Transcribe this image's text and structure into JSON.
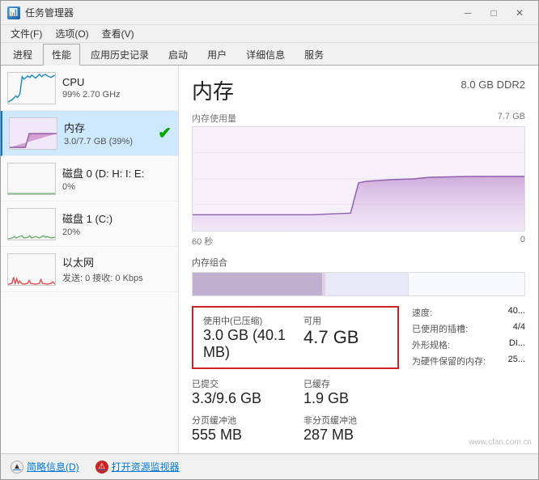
{
  "window": {
    "title": "任务管理器",
    "icon": "📊"
  },
  "titlebar": {
    "minimize": "─",
    "maximize": "□",
    "close": "✕"
  },
  "menubar": {
    "items": [
      "文件(F)",
      "选项(O)",
      "查看(V)"
    ]
  },
  "tabs": [
    {
      "label": "进程",
      "active": false
    },
    {
      "label": "性能",
      "active": true
    },
    {
      "label": "应用历史记录",
      "active": false
    },
    {
      "label": "启动",
      "active": false
    },
    {
      "label": "用户",
      "active": false
    },
    {
      "label": "详细信息",
      "active": false
    },
    {
      "label": "服务",
      "active": false
    }
  ],
  "sidebar": {
    "items": [
      {
        "id": "cpu",
        "label": "CPU",
        "sublabel": "99% 2.70 GHz",
        "active": false
      },
      {
        "id": "memory",
        "label": "内存",
        "sublabel": "3.0/7.7 GB (39%)",
        "active": true,
        "check": true
      },
      {
        "id": "disk0",
        "label": "磁盘 0 (D: H: I: E:",
        "sublabel": "0%",
        "active": false
      },
      {
        "id": "disk1",
        "label": "磁盘 1 (C:)",
        "sublabel": "20%",
        "active": false
      },
      {
        "id": "ethernet",
        "label": "以太网",
        "sublabel": "发送: 0 接收: 0 Kbps",
        "active": false
      }
    ]
  },
  "panel": {
    "title": "内存",
    "type_label": "8.0 GB DDR2",
    "usage_label": "内存使用量",
    "usage_max": "7.7 GB",
    "time_label_left": "60 秒",
    "time_label_right": "0",
    "composition_label": "内存组合",
    "stats": {
      "in_use_label": "使用中(已压缩)",
      "in_use_value": "3.0 GB (40.1 MB)",
      "available_label": "可用",
      "available_value": "4.7 GB",
      "committed_label": "已提交",
      "committed_value": "3.3/9.6 GB",
      "cached_label": "已缓存",
      "cached_value": "1.9 GB",
      "paged_pool_label": "分页缓冲池",
      "paged_pool_value": "555 MB",
      "nonpaged_pool_label": "非分页缓冲池",
      "nonpaged_pool_value": "287 MB"
    },
    "side_stats": {
      "speed_label": "速度:",
      "speed_value": "40...",
      "slots_label": "已使用的插槽:",
      "slots_value": "4/4",
      "form_label": "外形规格:",
      "form_value": "DI...",
      "reserved_label": "为硬件保留的内存:",
      "reserved_value": "25..."
    }
  },
  "bottom": {
    "summary_label": "简略信息(D)",
    "monitor_label": "打开资源监视器"
  },
  "watermark": "www.cfan.com.cn"
}
